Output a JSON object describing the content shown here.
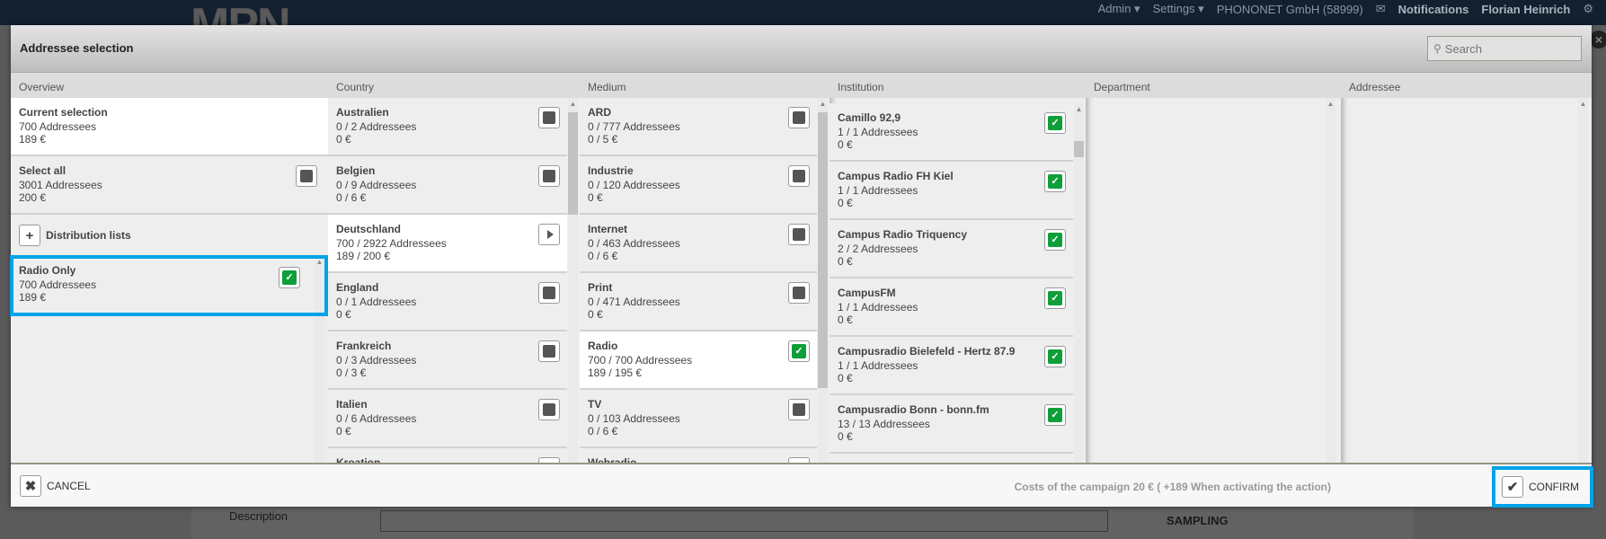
{
  "topbar": {
    "logo": "MPN",
    "admin": "Admin ▾",
    "settings": "Settings ▾",
    "company": "PHONONET GmbH (58999)",
    "notifications": "Notifications",
    "user": "Florian Heinrich"
  },
  "background": {
    "description_label": "Description",
    "sampling_label": "SAMPLING"
  },
  "modal": {
    "title": "Addressee selection",
    "search_placeholder": "Search",
    "columns": {
      "overview": "Overview",
      "country": "Country",
      "medium": "Medium",
      "institution": "Institution",
      "department": "Department",
      "addressee": "Addressee"
    },
    "overview": {
      "current": {
        "title": "Current selection",
        "count": "700 Addressees",
        "cost": "189 €"
      },
      "select_all": {
        "title": "Select all",
        "count": "3001 Addressees",
        "cost": "200 €",
        "state": "off"
      },
      "distribution_lists": "Distribution lists",
      "lists": [
        {
          "title": "Radio Only",
          "count": "700 Addressees",
          "cost": "189 €",
          "state": "on"
        }
      ]
    },
    "country": [
      {
        "title": "Australien",
        "count": "0 / 2 Addressees",
        "cost": "0 €",
        "state": "off"
      },
      {
        "title": "Belgien",
        "count": "0 / 9 Addressees",
        "cost": "0 / 6 €",
        "state": "off"
      },
      {
        "title": "Deutschland",
        "count": "700 / 2922 Addressees",
        "cost": "189 / 200 €",
        "state": "play",
        "selected": true
      },
      {
        "title": "England",
        "count": "0 / 1 Addressees",
        "cost": "0 €",
        "state": "off"
      },
      {
        "title": "Frankreich",
        "count": "0 / 3 Addressees",
        "cost": "0 / 3 €",
        "state": "off"
      },
      {
        "title": "Italien",
        "count": "0 / 6 Addressees",
        "cost": "0 €",
        "state": "off"
      },
      {
        "title": "Kroation",
        "count": "",
        "cost": "",
        "state": "empty"
      }
    ],
    "medium": [
      {
        "title": "ARD",
        "count": "0 / 777 Addressees",
        "cost": "0 / 5 €",
        "state": "off"
      },
      {
        "title": "Industrie",
        "count": "0 / 120 Addressees",
        "cost": "0 €",
        "state": "off"
      },
      {
        "title": "Internet",
        "count": "0 / 463 Addressees",
        "cost": "0 / 6 €",
        "state": "off"
      },
      {
        "title": "Print",
        "count": "0 / 471 Addressees",
        "cost": "0 €",
        "state": "off"
      },
      {
        "title": "Radio",
        "count": "700 / 700 Addressees",
        "cost": "189 / 195 €",
        "state": "on",
        "selected": true
      },
      {
        "title": "TV",
        "count": "0 / 103 Addressees",
        "cost": "0 / 6 €",
        "state": "off"
      },
      {
        "title": "Webradio",
        "count": "",
        "cost": "",
        "state": "empty"
      }
    ],
    "institution": [
      {
        "title": "Camillo 92,9",
        "count": "1 / 1 Addressees",
        "cost": "0 €",
        "state": "on"
      },
      {
        "title": "Campus Radio FH Kiel",
        "count": "1 / 1 Addressees",
        "cost": "0 €",
        "state": "on"
      },
      {
        "title": "Campus Radio Triquency",
        "count": "2 / 2 Addressees",
        "cost": "0 €",
        "state": "on"
      },
      {
        "title": "CampusFM",
        "count": "1 / 1 Addressees",
        "cost": "0 €",
        "state": "on"
      },
      {
        "title": "Campusradio Bielefeld - Hertz 87.9",
        "count": "1 / 1 Addressees",
        "cost": "0 €",
        "state": "on"
      },
      {
        "title": "Campusradio Bonn - bonn.fm",
        "count": "13 / 13 Addressees",
        "cost": "0 €",
        "state": "on"
      },
      {
        "title": "",
        "count": "",
        "cost": "",
        "state": "empty"
      }
    ],
    "footer": {
      "cancel": "CANCEL",
      "cost_text": "Costs of the campaign 20 € ( +189 When activating the action)",
      "confirm": "CONFIRM"
    }
  },
  "colors": {
    "accent": "#00a3e8",
    "checked": "#0e9e3a",
    "topbar": "#13202f"
  }
}
